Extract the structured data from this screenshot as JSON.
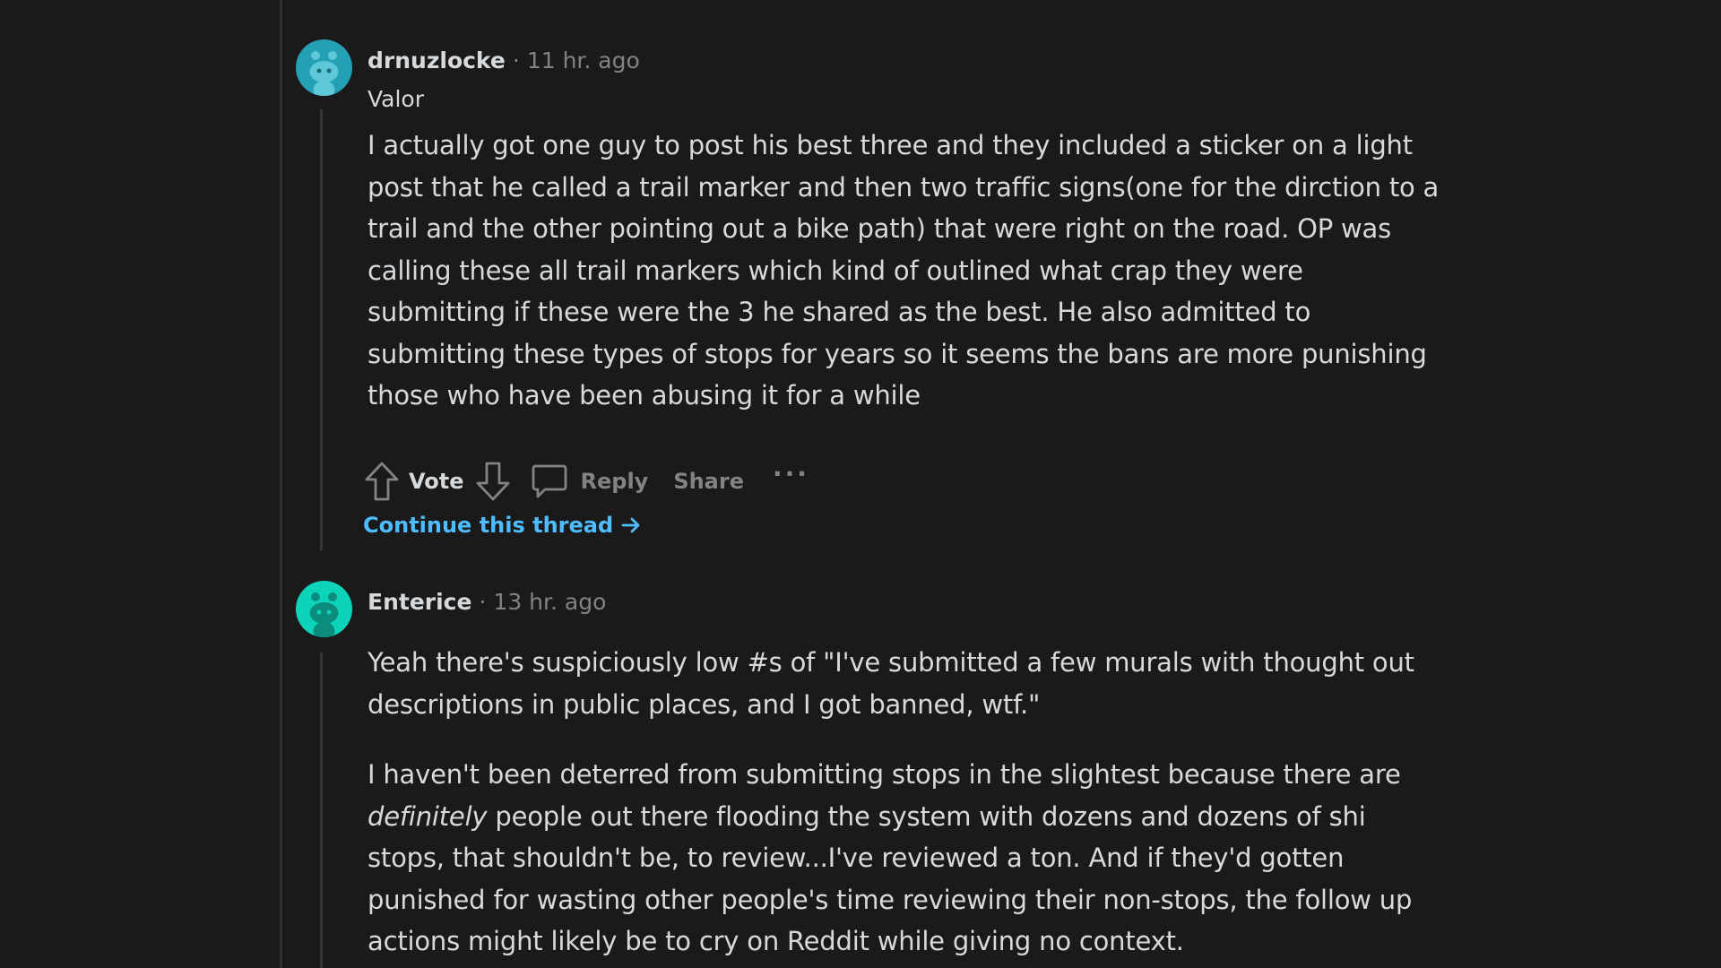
{
  "comments": [
    {
      "author": "drnuzlocke",
      "separator": "·",
      "time": "11 hr. ago",
      "flair": "Valor",
      "avatar_color": "#24a0b4",
      "body": [
        "I actually got one guy to post his best three and they included a sticker on a light post that he called a trail marker and then two traffic signs(one for the dirction to a trail and the other pointing out a bike path) that were right on the road. OP was calling these all trail markers which kind of outlined what crap they were submitting if these were the 3 he shared as the best. He also admitted to submitting these types of stops for years so it seems the bans are more punishing those who have been abusing it for a while"
      ],
      "actions": {
        "upvote_icon": "arrow-up-icon",
        "vote_label": "Vote",
        "downvote_icon": "arrow-down-icon",
        "reply_icon": "comment-bubble-icon",
        "reply_label": "Reply",
        "share_label": "Share",
        "more_label": "···"
      },
      "continue_label": "Continue this thread",
      "continue_icon": "arrow-right-icon"
    },
    {
      "author": "Enterice",
      "separator": "·",
      "time": "13 hr. ago",
      "avatar_color": "#0dd3bb",
      "body_p1": "Yeah there's suspiciously low #s of \"I've submitted a few murals with thought out descriptions in public places, and I got banned, wtf.\"",
      "body_p2_before": "I haven't been deterred from submitting stops in the slightest because there are ",
      "body_p2_em": "definitely",
      "body_p2_after": " people out there flooding the system with dozens and dozens of shi      stops, that shouldn't be, to review...I've reviewed a ton. And if they'd gotten punished for wasting other people's time reviewing their non-stops, the follow up actions might likely be to cry on Reddit while giving no context."
    }
  ],
  "colors": {
    "background": "#1a1a1b",
    "text": "#d7dadc",
    "muted": "#818384",
    "link": "#4fbcff"
  }
}
